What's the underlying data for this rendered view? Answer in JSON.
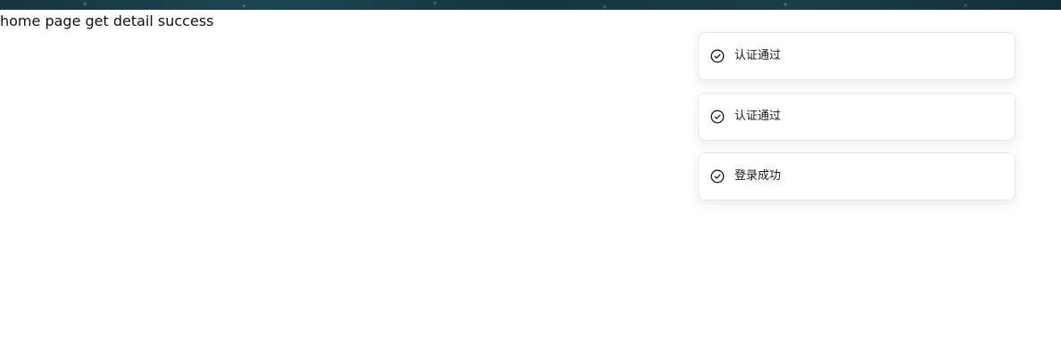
{
  "page": {
    "status_message": "home page get detail success"
  },
  "toasts": [
    {
      "icon": "check-circle-icon",
      "message": "认证通过"
    },
    {
      "icon": "check-circle-icon",
      "message": "认证通过"
    },
    {
      "icon": "check-circle-icon",
      "message": "登录成功"
    }
  ],
  "colors": {
    "banner": "#1a3e48",
    "toast_background": "#ffffff",
    "toast_border": "#e6e6e6",
    "text": "#171717"
  }
}
